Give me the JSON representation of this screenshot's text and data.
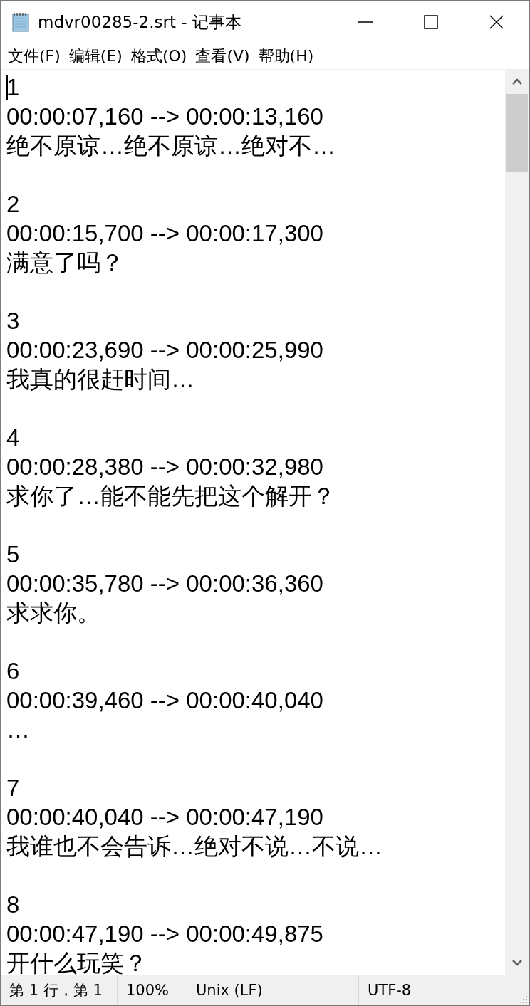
{
  "window": {
    "title": "mdvr00285-2.srt - 记事本"
  },
  "menu": [
    "文件(F)",
    "编辑(E)",
    "格式(O)",
    "查看(V)",
    "帮助(H)"
  ],
  "entries": [
    {
      "number": "1",
      "time": "00:00:07,160 --> 00:00:13,160",
      "text": "绝不原谅…绝不原谅…绝对不…"
    },
    {
      "number": "2",
      "time": "00:00:15,700 --> 00:00:17,300",
      "text": "满意了吗？"
    },
    {
      "number": "3",
      "time": "00:00:23,690 --> 00:00:25,990",
      "text": "我真的很赶时间…"
    },
    {
      "number": "4",
      "time": "00:00:28,380 --> 00:00:32,980",
      "text": "求你了…能不能先把这个解开？"
    },
    {
      "number": "5",
      "time": "00:00:35,780 --> 00:00:36,360",
      "text": "求求你。"
    },
    {
      "number": "6",
      "time": "00:00:39,460 --> 00:00:40,040",
      "text": "…"
    },
    {
      "number": "7",
      "time": "00:00:40,040 --> 00:00:47,190",
      "text": "我谁也不会告诉…绝对不说…不说…"
    },
    {
      "number": "8",
      "time": "00:00:47,190 --> 00:00:49,875",
      "text": "开什么玩笑？"
    }
  ],
  "status_bar": {
    "position": "第 1 行，第 1",
    "zoom": "100%",
    "line_ending": "Unix (LF)",
    "encoding": "UTF-8"
  }
}
